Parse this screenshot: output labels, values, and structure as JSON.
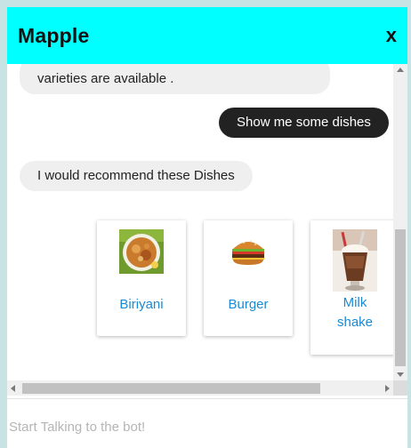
{
  "header": {
    "title": "Mapple",
    "close_label": "x"
  },
  "chat": {
    "messages": [
      {
        "from": "bot",
        "text": "varieties are available ."
      },
      {
        "from": "user",
        "text": "Show me some dishes"
      },
      {
        "from": "bot",
        "text": "I would recommend these Dishes"
      }
    ],
    "dishes": [
      {
        "label": "Biriyani",
        "icon": "biriyani-image"
      },
      {
        "label": "Burger",
        "icon": "burger-image"
      },
      {
        "label_line1": "Milk",
        "label_line2": "shake",
        "icon": "milkshake-image"
      }
    ]
  },
  "input": {
    "placeholder": "Start Talking to the bot!",
    "value": ""
  },
  "colors": {
    "header": "#00ffff",
    "user_bubble": "#222222",
    "bot_bubble": "#efefef",
    "link": "#1a8ad4"
  }
}
